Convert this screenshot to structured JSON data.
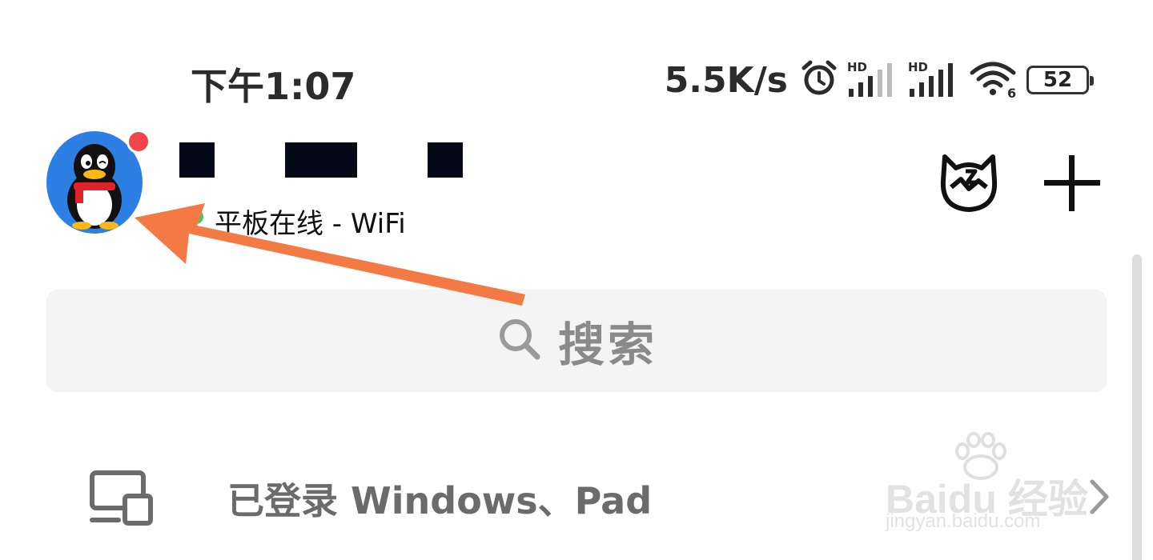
{
  "status_bar": {
    "time": "下午1:07",
    "net_speed": "5.5K/s",
    "battery_level": "52",
    "icons": [
      "alarm-icon",
      "signal-hd-1-icon",
      "signal-hd-2-icon",
      "wifi-6-icon",
      "battery-icon"
    ]
  },
  "header": {
    "presence_text": "平板在线 - WiFi",
    "presence_color": "#3fca63",
    "notification_dot_color": "#f2444a",
    "right_icons": [
      "cat-face-icon",
      "add-icon"
    ]
  },
  "search": {
    "placeholder": "搜索"
  },
  "devices_row": {
    "label": "已登录 Windows、Pad"
  },
  "watermark": {
    "brand": "Baidu 经验",
    "url": "jingyan.baidu.com"
  },
  "annotation": {
    "arrow_color": "#f47a45"
  }
}
